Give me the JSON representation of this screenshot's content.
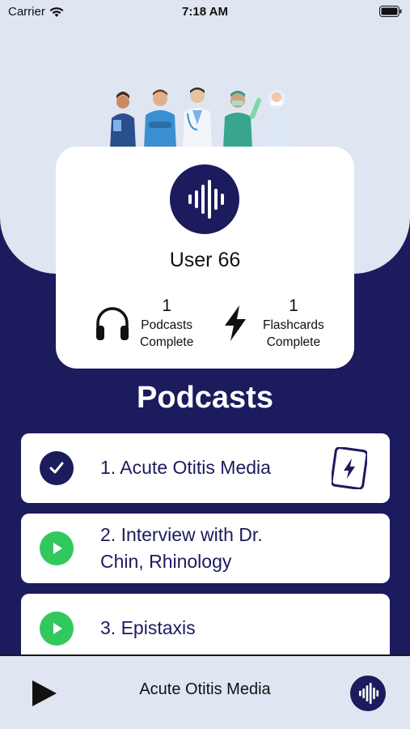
{
  "status_bar": {
    "carrier": "Carrier",
    "time": "7:18 AM",
    "icons": [
      "wifi-icon",
      "battery-icon"
    ]
  },
  "profile": {
    "avatar_icon": "soundwave-icon",
    "username": "User 66",
    "stats": [
      {
        "icon": "headphones-icon",
        "count": "1",
        "line1": "Podcasts",
        "line2": "Complete"
      },
      {
        "icon": "lightning-icon",
        "count": "1",
        "line1": "Flashcards",
        "line2": "Complete"
      }
    ]
  },
  "section_title": "Podcasts",
  "podcasts": [
    {
      "title": "1. Acute Otitis Media",
      "status": "completed",
      "icon": "checkmark-icon",
      "has_flashcards": true
    },
    {
      "title_line1": "2. Interview with Dr.",
      "title_line2": "Chin, Rhinology",
      "status": "unplayed",
      "icon": "play-icon"
    },
    {
      "title": "3. Epistaxis",
      "status": "unplayed",
      "icon": "play-icon"
    }
  ],
  "player": {
    "now_playing": "Acute Otitis Media",
    "play_icon": "play-icon",
    "logo_icon": "soundwave-icon"
  },
  "colors": {
    "navy": "#1c1b5e",
    "light_blue": "#dfe6f1",
    "green": "#31c95d",
    "white": "#ffffff"
  }
}
